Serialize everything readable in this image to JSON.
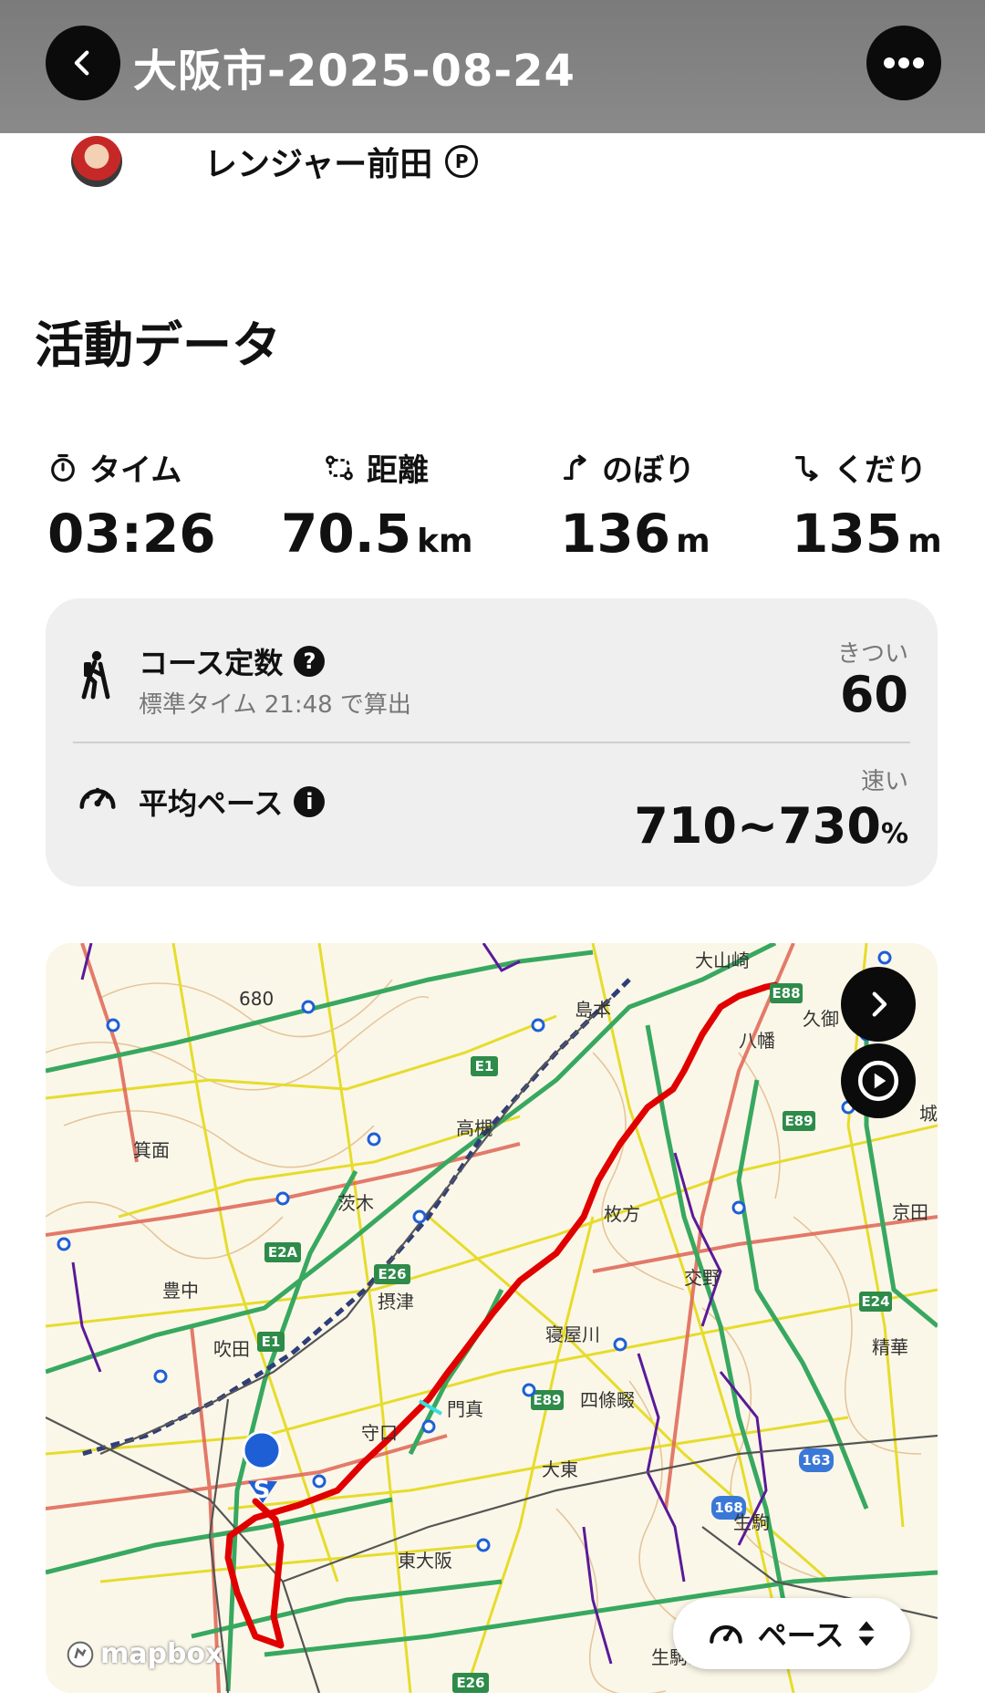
{
  "header": {
    "title": "大阪市-2025-08-24"
  },
  "user": {
    "name": "レンジャー前田",
    "badge": "P"
  },
  "section_title": "活動データ",
  "stats": [
    {
      "label": "タイム",
      "value": "03:26",
      "unit": "",
      "icon": "stopwatch-icon"
    },
    {
      "label": "距離",
      "value": "70.5",
      "unit": "km",
      "icon": "route-icon"
    },
    {
      "label": "のぼり",
      "value": "136",
      "unit": "m",
      "icon": "ascent-icon"
    },
    {
      "label": "くだり",
      "value": "135",
      "unit": "m",
      "icon": "descent-icon"
    }
  ],
  "course": {
    "title": "コース定数",
    "subtitle": "標準タイム 21:48 で算出",
    "tag": "きつい",
    "value": "60"
  },
  "pace": {
    "title": "平均ペース",
    "tag": "速い",
    "value": "710~730",
    "unit": "%"
  },
  "map": {
    "labels": [
      "大山崎",
      "島本",
      "八幡",
      "久御",
      "城",
      "高槻",
      "箕面",
      "茨木",
      "枚方",
      "京田",
      "豊中",
      "摂津",
      "交野",
      "吹田",
      "寝屋川",
      "精華",
      "門真",
      "四條畷",
      "守口",
      "大東",
      "東大阪",
      "生駒山",
      "生駒",
      "680"
    ],
    "road_labels": [
      "E88",
      "E1",
      "E89",
      "E2A",
      "E26",
      "E1",
      "E89",
      "E24",
      "163",
      "168",
      "E26"
    ],
    "pace_button": "ペース",
    "attribution": "mapbox",
    "start_marker": "S",
    "route_color": "#e00000"
  }
}
